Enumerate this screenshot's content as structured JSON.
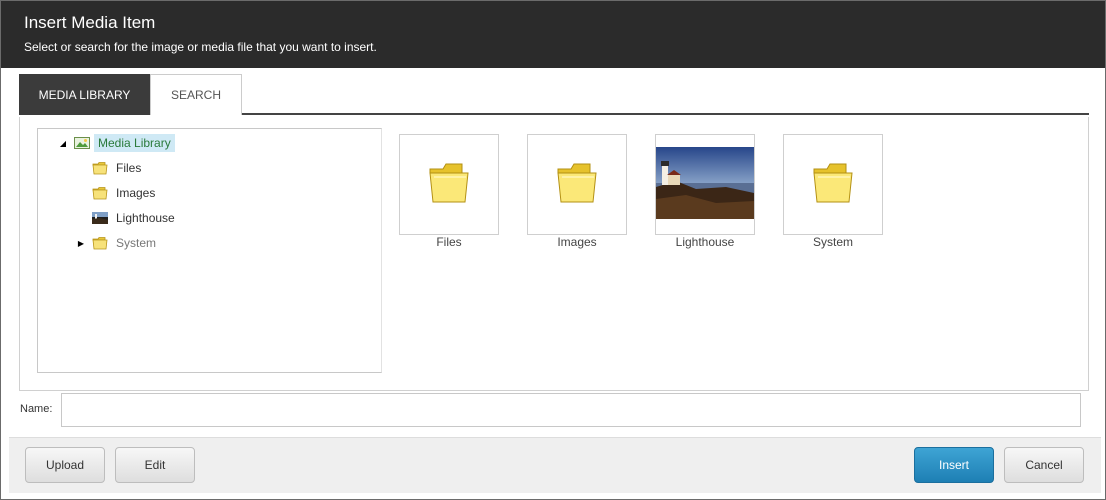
{
  "dialog": {
    "title": "Insert Media Item",
    "subtitle": "Select or search for the image or media file that you want to insert."
  },
  "tabs": [
    {
      "label": "MEDIA LIBRARY",
      "active": true
    },
    {
      "label": "SEARCH",
      "active": false
    }
  ],
  "tree": {
    "root": {
      "label": "Media Library",
      "icon": "media-library-icon",
      "expanded": true,
      "selected": true
    },
    "children": [
      {
        "label": "Files",
        "icon": "folder-icon"
      },
      {
        "label": "Images",
        "icon": "folder-icon"
      },
      {
        "label": "Lighthouse",
        "icon": "image-thumbnail-icon"
      },
      {
        "label": "System",
        "icon": "folder-icon",
        "expandable": true
      }
    ]
  },
  "thumbnails": [
    {
      "label": "Files",
      "icon": "folder-icon"
    },
    {
      "label": "Images",
      "icon": "folder-icon"
    },
    {
      "label": "Lighthouse",
      "icon": "lighthouse-photo"
    },
    {
      "label": "System",
      "icon": "folder-icon"
    }
  ],
  "name_field": {
    "label": "Name:",
    "value": ""
  },
  "buttons": {
    "upload": "Upload",
    "edit": "Edit",
    "insert": "Insert",
    "cancel": "Cancel"
  },
  "colors": {
    "header_bg": "#2b2b2b",
    "active_tab_bg": "#3b3b3b",
    "primary_button": "#2790c5",
    "selected_node_bg": "#cfe9f5"
  }
}
